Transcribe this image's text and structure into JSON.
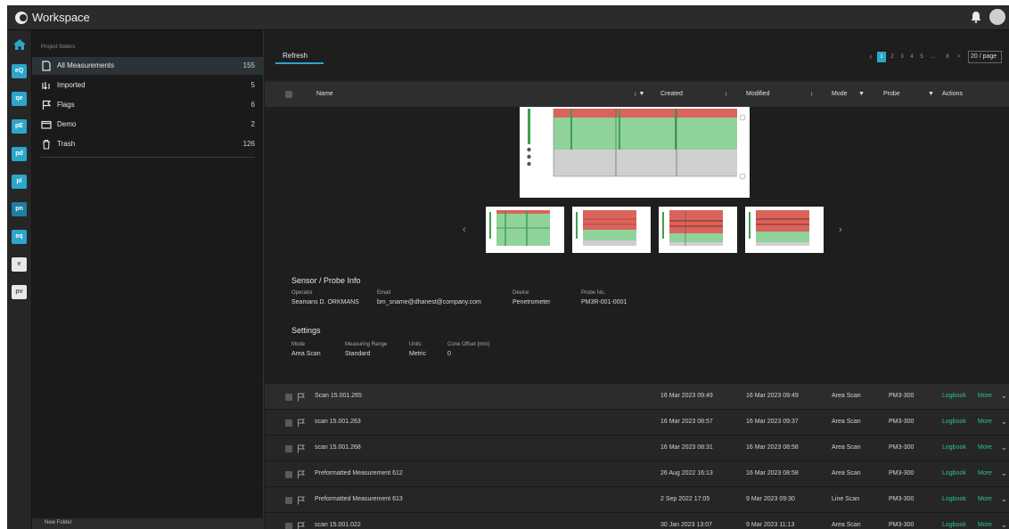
{
  "app": {
    "title": "Workspace"
  },
  "colors": {
    "accent": "#2aa7c9",
    "link": "#27c2a0",
    "bg": "#1f1f1f"
  },
  "rail": {
    "apps": [
      {
        "label": "eQ",
        "icon": "app-eq-icon"
      },
      {
        "label": "qe",
        "icon": "app-qe-icon"
      },
      {
        "label": "pE",
        "icon": "app-pe-icon"
      },
      {
        "label": "pd",
        "icon": "app-pd-icon"
      },
      {
        "label": "pl",
        "icon": "app-pl-icon"
      },
      {
        "label": "pn",
        "icon": "app-pn-icon"
      },
      {
        "label": "eq",
        "icon": "app-eq2-icon"
      },
      {
        "label": "e",
        "icon": "app-e-icon"
      },
      {
        "label": "pv",
        "icon": "app-pv-icon"
      }
    ]
  },
  "sidebar": {
    "heading": "Project folders",
    "items": [
      {
        "label": "All Measurements",
        "count": "155",
        "icon": "document-icon"
      },
      {
        "label": "Imported",
        "count": "5",
        "icon": "import-icon"
      },
      {
        "label": "Flags",
        "count": "6",
        "icon": "flag-icon"
      },
      {
        "label": "Demo",
        "count": "2",
        "icon": "folder-icon"
      },
      {
        "label": "Trash",
        "count": "126",
        "icon": "trash-icon"
      }
    ],
    "footer": "New Folder"
  },
  "main": {
    "tab": "Refresh",
    "pager": {
      "pages": [
        "1",
        "2",
        "3",
        "4",
        "5",
        "…",
        "8",
        ">"
      ],
      "per_page": "20 / page"
    },
    "columns": {
      "name": "Name",
      "created": "Created",
      "modified": "Modified",
      "mode": "Mode",
      "probe": "Probe",
      "actions": "Actions"
    }
  },
  "detail": {
    "probe_info_title": "Sensor / Probe Info",
    "probe_fields": [
      {
        "label": "Operator",
        "value": "Seamans D. ORKMANS"
      },
      {
        "label": "Email",
        "value": "bm_sname@dhanest@company.com"
      },
      {
        "label": "Device",
        "value": "Penetrometer"
      },
      {
        "label": "Probe No.",
        "value": "PM3R-001-0001"
      }
    ],
    "settings_title": "Settings",
    "settings_fields": [
      {
        "label": "Mode",
        "value": "Area Scan"
      },
      {
        "label": "Measuring Range",
        "value": "Standard"
      },
      {
        "label": "Units",
        "value": "Metric"
      },
      {
        "label": "Cone Offset [mm]",
        "value": "0"
      }
    ]
  },
  "rows": [
    {
      "name": "Scan 15.001.265",
      "created": "16 Mar 2023 09:49",
      "modified": "16 Mar 2023 09:49",
      "mode": "Area Scan",
      "probe": "PM3-300",
      "logbook": "Logbook",
      "more": "More"
    },
    {
      "name": "scan 15.001.263",
      "created": "16 Mar 2023 08:57",
      "modified": "16 Mar 2023 09:37",
      "mode": "Area Scan",
      "probe": "PM3-300",
      "logbook": "Logbook",
      "more": "More"
    },
    {
      "name": "scan 15.001.268",
      "created": "16 Mar 2023 08:31",
      "modified": "16 Mar 2023 08:58",
      "mode": "Area Scan",
      "probe": "PM3-300",
      "logbook": "Logbook",
      "more": "More"
    },
    {
      "name": "Preformatted Measurement 612",
      "created": "26 Aug 2022 16:13",
      "modified": "16 Mar 2023 08:58",
      "mode": "Area Scan",
      "probe": "PM3-300",
      "logbook": "Logbook",
      "more": "More"
    },
    {
      "name": "Preformatted Measurement 613",
      "created": "2 Sep 2022 17:05",
      "modified": "9 Mar 2023 09:30",
      "mode": "Line Scan",
      "probe": "PM3-300",
      "logbook": "Logbook",
      "more": "More"
    },
    {
      "name": "scan 15.001.022",
      "created": "30 Jan 2023 13:07",
      "modified": "9 Mar 2023 11:13",
      "mode": "Area Scan",
      "probe": "PM3-300",
      "logbook": "Logbook",
      "more": "More"
    }
  ]
}
